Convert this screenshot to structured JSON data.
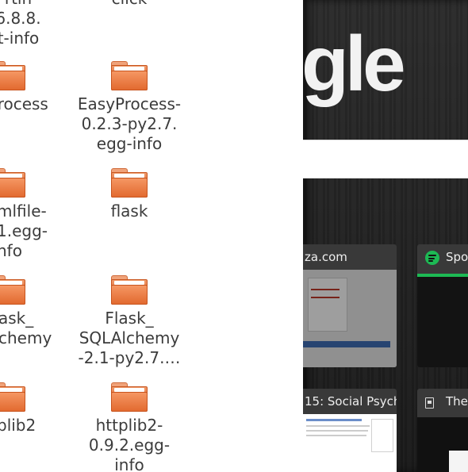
{
  "file_manager": {
    "items": [
      {
        "label": "rtin\n6.8.8.\nt-info"
      },
      {
        "label": "click"
      },
      {
        "label": "process"
      },
      {
        "label": "EasyProcess-\n0.2.3-py2.7.\negg-info"
      },
      {
        "label": "mlfile-\n1.egg-\nnfo"
      },
      {
        "label": "flask"
      },
      {
        "label": "ask_\nchemy"
      },
      {
        "label": "Flask_\nSQLAlchemy\n-2.1-py2.7.…"
      },
      {
        "label": "plib2"
      },
      {
        "label": "httplib2-\n0.9.2.egg-\ninfo"
      }
    ]
  },
  "browser": {
    "logo_text": "gle",
    "tiles": [
      {
        "title": "za.com",
        "icon": "none"
      },
      {
        "title": "Spo",
        "icon": "spotify-icon",
        "accent": "#1db954"
      },
      {
        "title": "15: Social Psych",
        "icon": "none"
      },
      {
        "title": "The",
        "icon": "document-icon"
      }
    ]
  }
}
